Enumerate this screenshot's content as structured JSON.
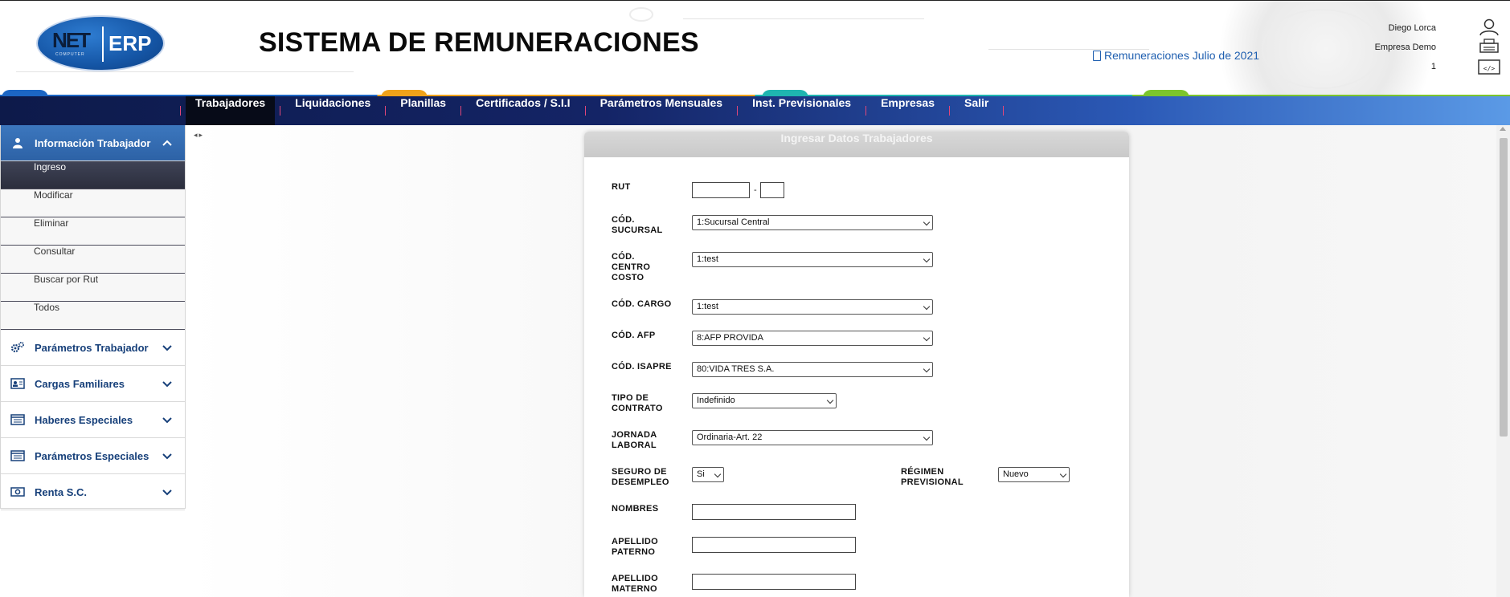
{
  "header": {
    "title": "SISTEMA DE REMUNERACIONES",
    "logo_left": "NET",
    "logo_right": "ERP",
    "logo_sub": "COMPUTER",
    "period_link": "Remuneraciones Julio de 2021",
    "user_name": "Diego Lorca",
    "company": "Empresa Demo",
    "company_code": "1",
    "icons": [
      "user-icon",
      "printer-icon",
      "code-icon"
    ]
  },
  "nav": {
    "items": [
      "Trabajadores",
      "Liquidaciones",
      "Planillas",
      "Certificados / S.I.I",
      "Parámetros Mensuales",
      "Inst. Previsionales",
      "Empresas",
      "Salir"
    ],
    "active": "Trabajadores"
  },
  "sidebar": {
    "sections": [
      {
        "label": "Información Trabajador",
        "icon": "user-icon",
        "open": true,
        "items": [
          "Ingreso",
          "Modificar",
          "Eliminar",
          "Consultar",
          "Buscar por Rut",
          "Todos"
        ],
        "active_item": "Ingreso"
      },
      {
        "label": "Parámetros Trabajador",
        "icon": "gears-icon",
        "open": false
      },
      {
        "label": "Cargas Familiares",
        "icon": "id-card-icon",
        "open": false
      },
      {
        "label": "Haberes Especiales",
        "icon": "list-icon",
        "open": false
      },
      {
        "label": "Parámetros Especiales",
        "icon": "list-icon",
        "open": false
      },
      {
        "label": "Renta S.C.",
        "icon": "money-icon",
        "open": false
      }
    ]
  },
  "form": {
    "title": "Ingresar Datos Trabajadores",
    "rut": {
      "label": "RUT",
      "number": "",
      "dv": "",
      "separator": "-"
    },
    "sucursal": {
      "label": "CÓD. SUCURSAL",
      "value": "1:Sucursal Central"
    },
    "centro_costo": {
      "label": "CÓD. CENTRO COSTO",
      "value": "1:test"
    },
    "cargo": {
      "label": "CÓD. CARGO",
      "value": "1:test"
    },
    "afp": {
      "label": "CÓD. AFP",
      "value": "8:AFP PROVIDA"
    },
    "isapre": {
      "label": "CÓD. ISAPRE",
      "value": "80:VIDA TRES S.A."
    },
    "tipo_contrato": {
      "label": "TIPO DE CONTRATO",
      "value": "Indefinido"
    },
    "jornada": {
      "label": "JORNADA LABORAL",
      "value": "Ordinaria-Art. 22"
    },
    "seguro_desempleo": {
      "label": "SEGURO DE DESEMPLEO",
      "value": "Si"
    },
    "regimen_previsional": {
      "label": "RÉGIMEN PREVISIONAL",
      "value": "Nuevo"
    },
    "nombres": {
      "label": "NOMBRES",
      "value": ""
    },
    "apellido_paterno": {
      "label": "APELLIDO PATERNO",
      "value": ""
    },
    "apellido_materno": {
      "label": "APELLIDO MATERNO",
      "value": ""
    }
  },
  "colors": {
    "nav_dark": "#0d1a4a",
    "nav_light": "#5b9ae6",
    "sidebar_active": "#2d62a6",
    "sidebar_text": "#17407a",
    "link": "#1f5fb0"
  }
}
